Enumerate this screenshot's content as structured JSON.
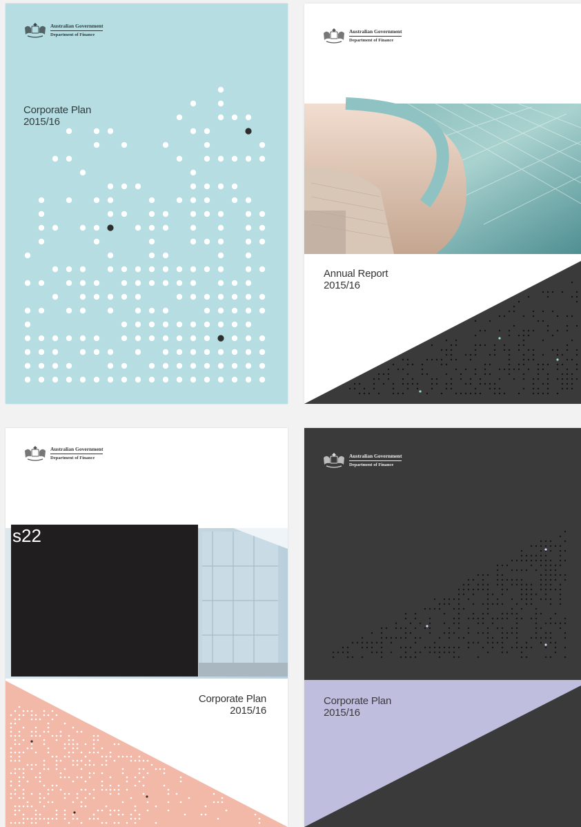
{
  "header": {
    "government": "Australian Government",
    "department": "Department of Finance"
  },
  "covers": [
    {
      "title": "Corporate Plan",
      "year": "2015/16",
      "background": "#b5dde2"
    },
    {
      "title": "Annual Report",
      "year": "2015/16",
      "background": "#ffffff"
    },
    {
      "title": "Corporate Plan",
      "year": "2015/16",
      "background": "#ffffff",
      "redaction_label": "s22"
    },
    {
      "title": "Corporate Plan",
      "year": "2015/16",
      "background": "#3a3a3a"
    }
  ],
  "colors": {
    "teal": "#b5dde2",
    "charcoal": "#3a3a3a",
    "salmon": "#f3b9a8",
    "lavender": "#bfbedf",
    "redaction": "#211e1f"
  },
  "icons": [
    "coat-of-arms-icon"
  ]
}
